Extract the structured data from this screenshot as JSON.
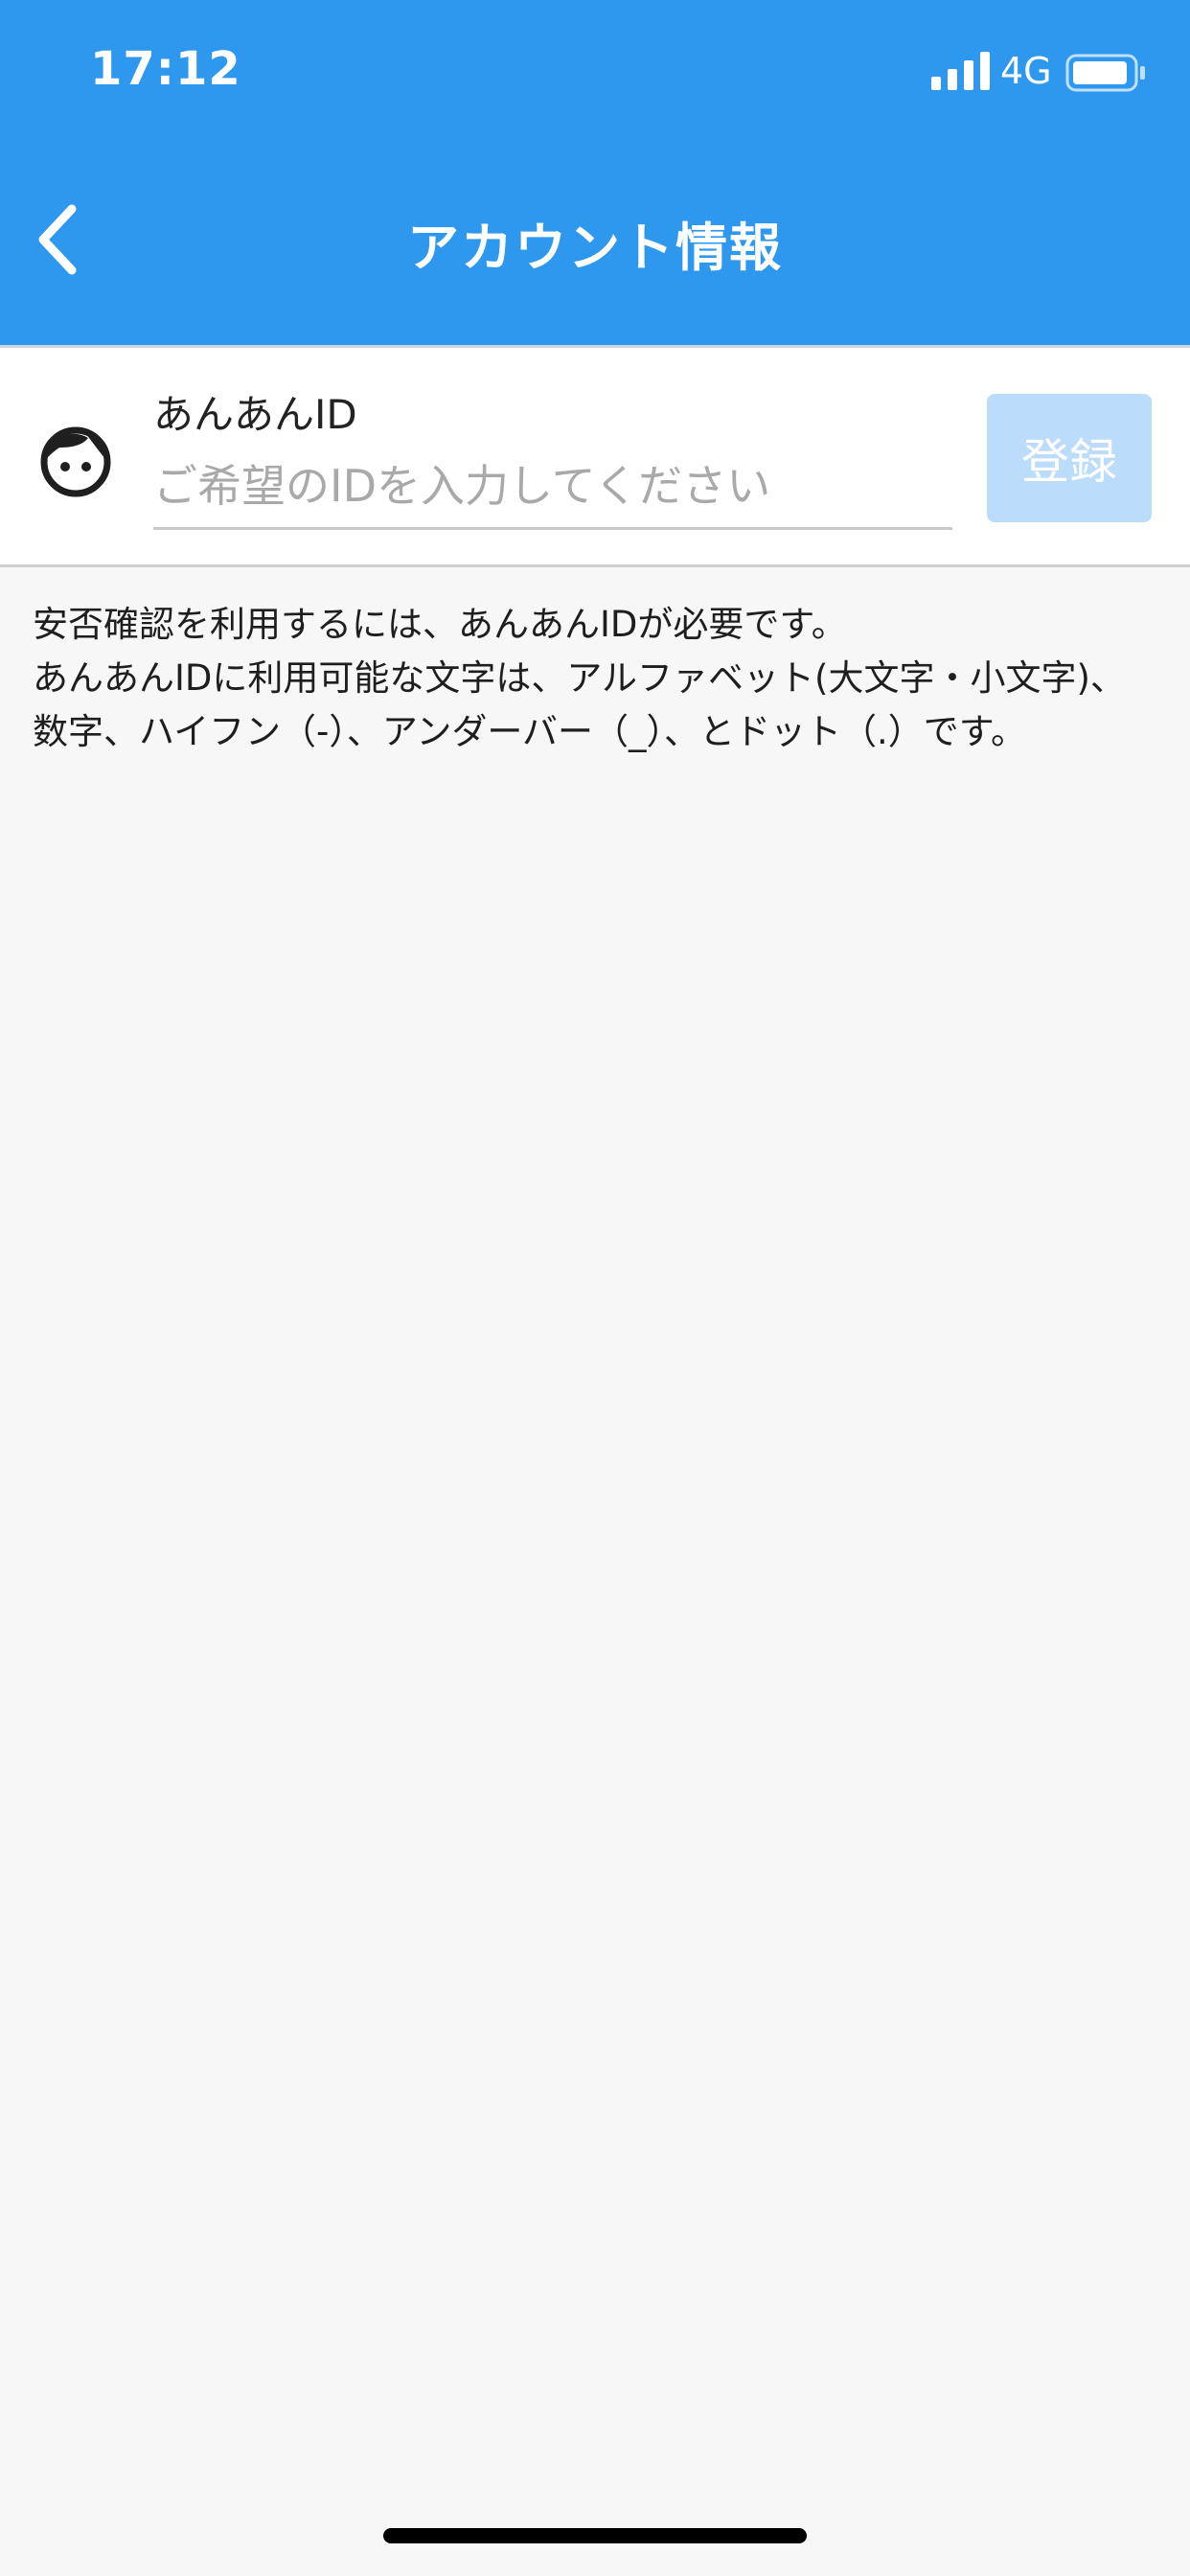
{
  "status_bar": {
    "time": "17:12",
    "network": "4G",
    "icons": [
      "signal-icon",
      "battery-icon"
    ]
  },
  "nav": {
    "back_icon": "chevron-left-icon",
    "title": "アカウント情報"
  },
  "form": {
    "avatar_icon": "face-icon",
    "label": "あんあんID",
    "placeholder": "ご希望のIDを入力してください",
    "value": "",
    "register_label": "登録"
  },
  "description": {
    "line1": "安否確認を利用するには、あんあんIDが必要です。",
    "line2": "あんあんIDに利用可能な文字は、アルファベット(大文字・小文字)、数字、ハイフン（-）、アンダーバー（_）、とドット（.）です。"
  },
  "colors": {
    "header": "#2e97ee",
    "register_button": "#bcdcfb",
    "background": "#f7f7f7"
  }
}
